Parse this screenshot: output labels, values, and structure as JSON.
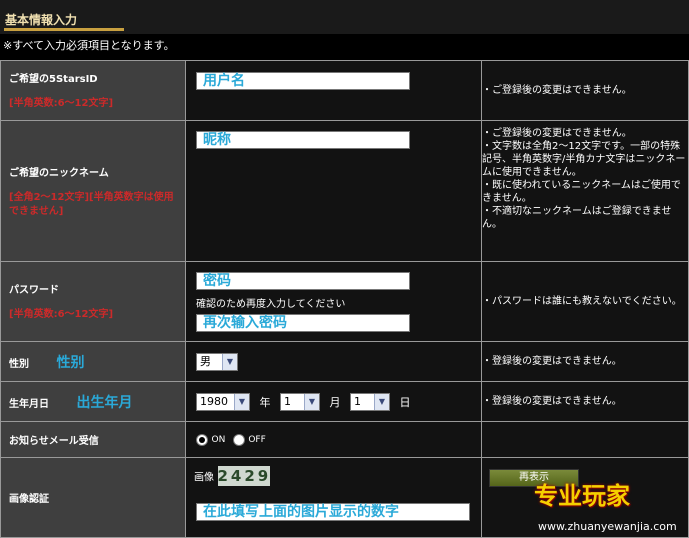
{
  "header": {
    "title": "基本情報入力",
    "note": "※すべて入力必須項目となります。"
  },
  "rows": {
    "id": {
      "label": "ご希望の5StarsID",
      "sub": "[半角英数:6～12文字]",
      "input": "用户名",
      "note": "・ご登録後の変更はできません。"
    },
    "nickname": {
      "label": "ご希望のニックネーム",
      "sub": "[全角2～12文字][半角英数字は使用できません]",
      "input": "昵称",
      "note": "・ご登録後の変更はできません。\n・文字数は全角2～12文字です。一部の特殊記号、半角英数字/半角カナ文字はニックネームに使用できません。\n・既に使われているニックネームはご使用できません。\n・不適切なニックネームはご登録できません。"
    },
    "password": {
      "label": "パスワード",
      "sub": "[半角英数:6～12文字]",
      "input": "密码",
      "confirm_text": "確認のため再度入力してください",
      "confirm_input": "再次输入密码",
      "note": "・パスワードは誰にも教えないでください。"
    },
    "gender": {
      "label": "性別",
      "cn_label": "性别",
      "selected": "男",
      "note": "・登録後の変更はできません。"
    },
    "birthday": {
      "label": "生年月日",
      "cn_label": "出生年月",
      "year": "1980",
      "year_unit": "年",
      "month": "1",
      "month_unit": "月",
      "day": "1",
      "day_unit": "日",
      "note": "・登録後の変更はできません。"
    },
    "newsletter": {
      "label": "お知らせメール受信",
      "on": "ON",
      "off": "OFF",
      "selected": "on"
    },
    "captcha": {
      "label": "画像認証",
      "image_label": "画像",
      "code": "2429",
      "input": "在此填写上面的图片显示的数字",
      "redisplay_label": "再表示"
    }
  },
  "watermark": {
    "logo": "专业玩家",
    "url": "www.zhuanyewanjia.com"
  },
  "colors": {
    "label_bg": "#3f3f3f",
    "cell_bg": "#121212",
    "sub_red": "#cc2a2a",
    "annot_blue": "#2aa9d8",
    "border": "#999999"
  }
}
